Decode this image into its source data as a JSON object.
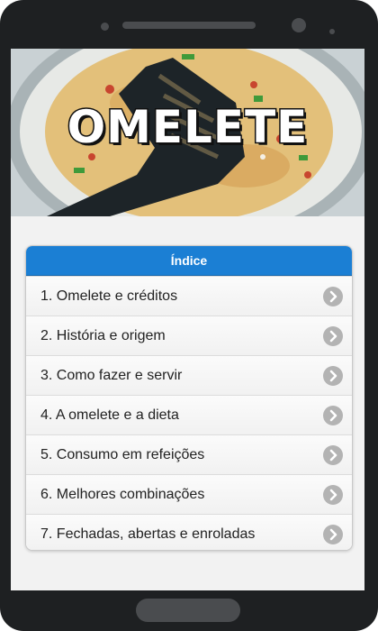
{
  "hero": {
    "title": "OMELETE"
  },
  "index": {
    "header": "Índice",
    "items": [
      {
        "label": "1. Omelete e créditos"
      },
      {
        "label": "2. História e origem"
      },
      {
        "label": "3. Como fazer e servir"
      },
      {
        "label": "4. A omelete e a dieta"
      },
      {
        "label": "5. Consumo em refeições"
      },
      {
        "label": "6. Melhores combinações"
      },
      {
        "label": "7. Fechadas, abertas e enroladas"
      }
    ]
  },
  "colors": {
    "header_blue": "#1b7fd4",
    "phone_frame": "#1e2022"
  }
}
